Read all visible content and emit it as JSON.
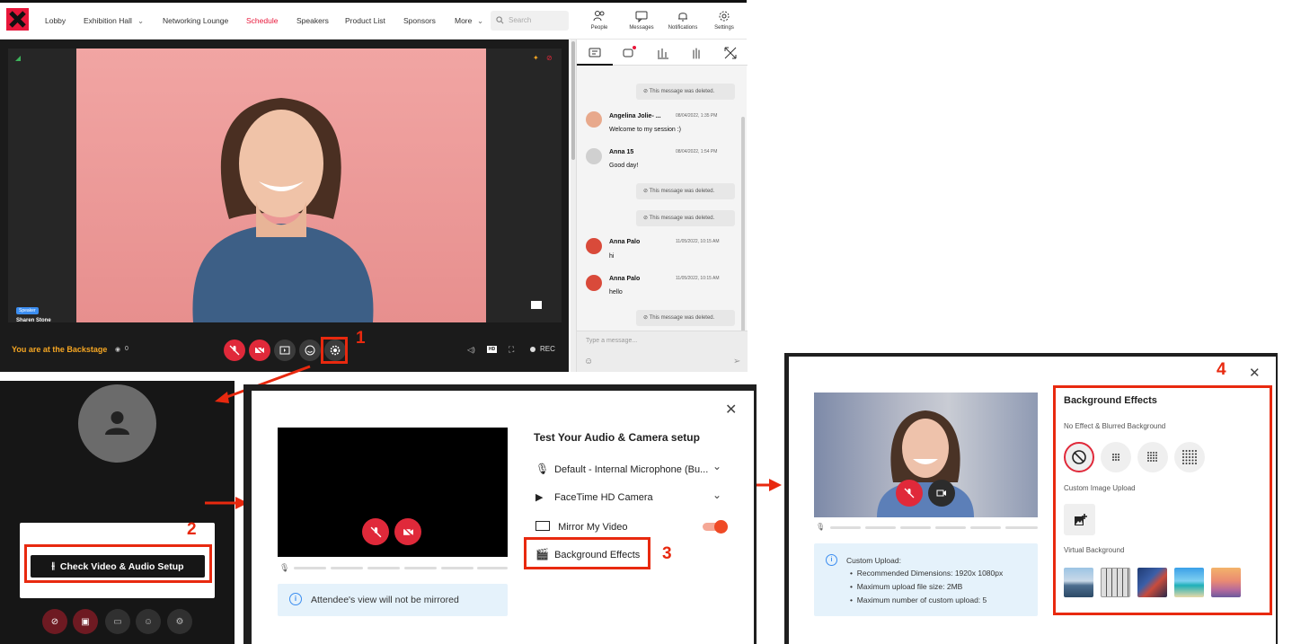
{
  "nav": {
    "items": [
      {
        "label": "Lobby",
        "active": false
      },
      {
        "label": "Exhibition Hall",
        "active": false
      },
      {
        "label": "Networking Lounge",
        "active": false
      },
      {
        "label": "Schedule",
        "active": true
      },
      {
        "label": "Speakers",
        "active": false
      },
      {
        "label": "Product List",
        "active": false
      },
      {
        "label": "Sponsors",
        "active": false
      },
      {
        "label": "More",
        "active": false
      }
    ],
    "search_placeholder": "Search",
    "icons": [
      {
        "label": "People",
        "icon": "people-icon"
      },
      {
        "label": "Messages",
        "icon": "messages-icon"
      },
      {
        "label": "Notifications",
        "icon": "bell-icon"
      },
      {
        "label": "Settings",
        "icon": "gear-icon"
      }
    ]
  },
  "stage": {
    "speaker_badge": "Speaker",
    "speaker_name": "Sharen Stone",
    "backstage_text": "You are at the Backstage",
    "viewer_count": "0",
    "rec_label": "REC",
    "hd_label": "HD"
  },
  "chat": {
    "deleted_text": "This message was deleted.",
    "messages": [
      {
        "name": "Angelina Jolie- ...",
        "time": "08/04/2022, 1:35 PM",
        "text": "Welcome to my session :)"
      },
      {
        "name": "Anna 15",
        "time": "08/04/2022, 1:54 PM",
        "text": "Good day!"
      },
      {
        "name": "Anna Palo",
        "time": "11/05/2022, 10:15 AM",
        "text": "hi"
      },
      {
        "name": "Anna Palo",
        "time": "11/05/2022, 10:15 AM",
        "text": "hello"
      }
    ],
    "input_placeholder": "Type a message..."
  },
  "step_labels": [
    "1",
    "2",
    "3",
    "4"
  ],
  "check_button_label": "Check Video & Audio Setup",
  "setup_modal": {
    "title": "Test Your Audio & Camera setup",
    "microphone": "Default - Internal Microphone (Bu...",
    "camera": "FaceTime HD Camera",
    "mirror_label": "Mirror My Video",
    "mirror_on": true,
    "background_effects_label": "Background Effects",
    "info_text": "Attendee's view will not be mirrored"
  },
  "effects_modal": {
    "title": "Background Effects",
    "section_blur": "No Effect & Blurred Background",
    "section_custom": "Custom Image Upload",
    "section_virtual": "Virtual Background",
    "custom_upload_title": "Custom Upload:",
    "custom_upload_items": [
      "Recommended Dimensions: 1920x 1080px",
      "Maximum upload file size: 2MB",
      "Maximum number of custom upload: 5"
    ]
  },
  "colors": {
    "accent": "#e8173a",
    "annotation": "#e8290f",
    "backstage": "#f5a623",
    "toggle": "#ef4a26"
  }
}
